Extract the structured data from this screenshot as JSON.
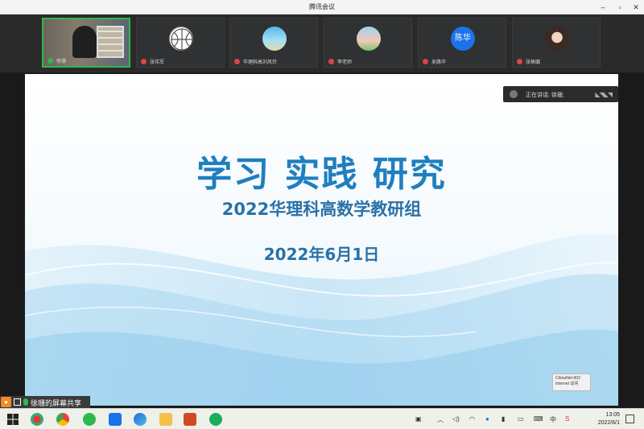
{
  "window": {
    "title": "腾讯会议"
  },
  "window_controls": [
    "minimize",
    "maximize",
    "close"
  ],
  "participants": [
    {
      "name": "徐珊",
      "status": "camera-on"
    },
    {
      "name": "张伟军",
      "status": "avatar"
    },
    {
      "name": "华理科高刘风玲",
      "status": "avatar"
    },
    {
      "name": "李老师",
      "status": "avatar"
    },
    {
      "name": "吴路华",
      "status": "avatar",
      "avatar_text": "陈华"
    },
    {
      "name": "张楠璐",
      "status": "avatar"
    }
  ],
  "speaking": {
    "label": "正在讲话: 徐珊;"
  },
  "slide": {
    "title": "学习  实践  研究",
    "subtitle": "2022华理科高数学教研组",
    "date": "2022年6月1日"
  },
  "network": {
    "name": "ChinaNet-902",
    "status": "Internet 访问"
  },
  "share_label": "徐珊的屏幕共享",
  "taskbar": {
    "time": "13:05",
    "date": "2022/6/1"
  },
  "colors": {
    "accent_green": "#2fb84c",
    "slide_title_blue": "#1e7fbf",
    "slide_text_blue": "#2a71a8"
  }
}
